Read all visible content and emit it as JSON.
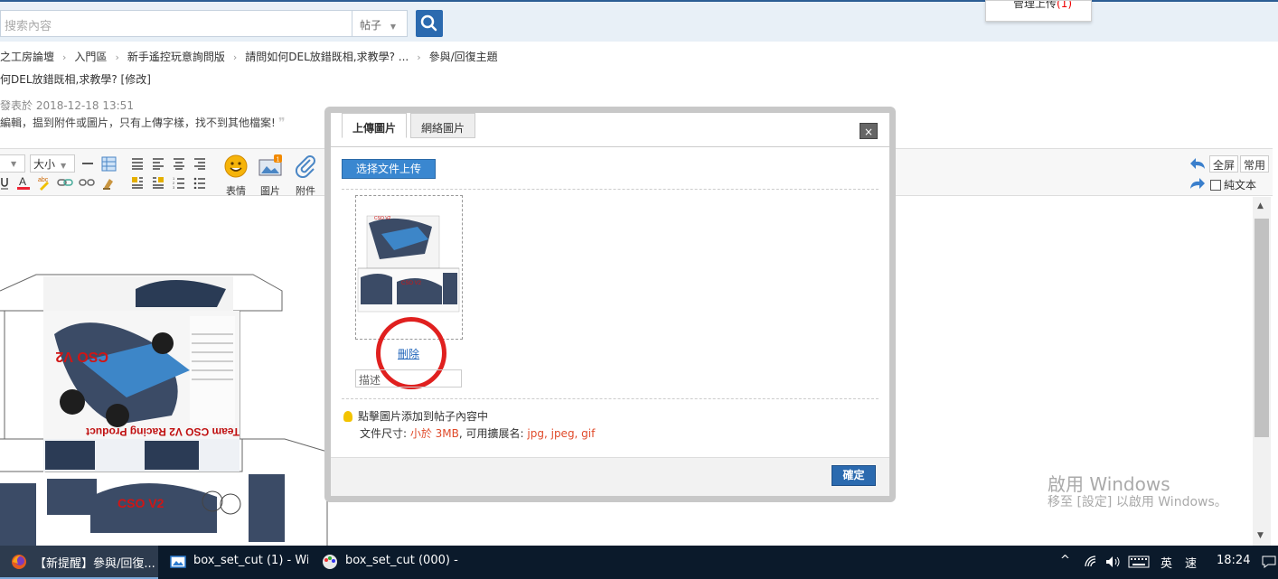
{
  "search": {
    "placeholder": "搜索內容",
    "type_label": "帖子",
    "caret": "▼"
  },
  "top_popup": {
    "text": "管理上传",
    "count_prefix": "(",
    "count": "1",
    "count_suffix": ")"
  },
  "breadcrumb": {
    "items": [
      "之工房論壇",
      "入門區",
      "新手遙控玩意詢問版",
      "請問如何DEL放錯既相,求教學? ...",
      "參與/回復主題"
    ],
    "sep": "›"
  },
  "thread": {
    "title": "何DEL放錯既相,求教學? [修改]",
    "meta": "發表於 2018-12-18 13:51",
    "quote": "編輯，揾到附件或圖片，只有上傳字樣，找不到其他檔案!",
    "quote_mark": "❞"
  },
  "toolbar": {
    "size_label": "大小",
    "smile_label": "表情",
    "image_label": "圖片",
    "attach_label": "附件",
    "fullscreen_label": "全屏",
    "common_label": "常用",
    "plaintext_label": "純文本",
    "image_badge": "1"
  },
  "dialog": {
    "tab_upload": "上傳圖片",
    "tab_web": "網絡圖片",
    "close": "×",
    "select_button": "选择文件上传",
    "delete_link": "刪除",
    "desc_value": "描述",
    "hint_text": "點擊圖片添加到帖子內容中",
    "filesize_label": "文件尺寸: ",
    "filesize_value": "小於 3MB",
    "ext_label": ", 可用擴展名: ",
    "ext_value": "jpg, jpeg, gif",
    "ok_button": "確定"
  },
  "watermark": {
    "line1": "啟用 Windows",
    "line2": "移至 [設定] 以啟用 Windows。"
  },
  "taskbar": {
    "items": [
      {
        "label": "【新提醒】參與/回復...",
        "icon": "firefox-icon"
      },
      {
        "label": "box_set_cut (1) - Wi...",
        "icon": "photos-icon"
      },
      {
        "label": "box_set_cut (000) - ...",
        "icon": "paint-icon"
      }
    ],
    "ime_lang": "英",
    "ime_mode": "速",
    "time": "18:24"
  },
  "colors": {
    "accent": "#2b6aaf",
    "annotation_red": "#e0201f",
    "taskbar": "#0b1a2b"
  }
}
